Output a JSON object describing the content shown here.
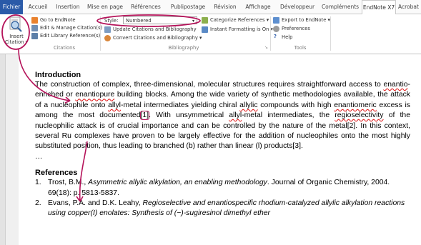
{
  "tabs": [
    {
      "label": "Fichier"
    },
    {
      "label": "Accueil"
    },
    {
      "label": "Insertion"
    },
    {
      "label": "Mise en page"
    },
    {
      "label": "Références"
    },
    {
      "label": "Publipostage"
    },
    {
      "label": "Révision"
    },
    {
      "label": "Affichage"
    },
    {
      "label": "Développeur"
    },
    {
      "label": "Compléments"
    },
    {
      "label": "EndNote X7"
    },
    {
      "label": "Acrobat"
    }
  ],
  "ribbon": {
    "insert_citation": {
      "line1": "Insert",
      "line2": "Citation ▾"
    },
    "citations_group": {
      "go_to_endnote": "Go to EndNote",
      "edit_manage": "Edit & Manage Citation(s)",
      "edit_library": "Edit Library Reference(s)",
      "label": "Citations"
    },
    "bibliography_group": {
      "style_label": "Style:",
      "style_value": "Numbered",
      "categorize": "Categorize References ▾",
      "update": "Update Citations and Bibliography",
      "instant": "Instant Formatting is On ▾",
      "convert": "Convert Citations and Bibliography ▾",
      "label": "Bibliography",
      "launcher": "↘"
    },
    "tools_group": {
      "export": "Export to EndNote ▾",
      "preferences": "Preferences",
      "help": "Help",
      "label": "Tools"
    }
  },
  "document": {
    "heading": "Introduction",
    "intro_para": {
      "s1": "The construction of complex, three-dimensional, molecular structures requires straightforward access to ",
      "w1": "enantio",
      "s2": "-enriched or ",
      "w2": "enantiopure",
      "s3": " building blocks. Among the wide variety of synthetic methodologies available, the attack of a nucleophile onto ",
      "w3": "allyl",
      "s4": "-metal intermediates yielding chiral ",
      "w4": "allylic",
      "s5": " compounds with high ",
      "w5": "enantiomeric",
      "s6": " excess is among the most documented",
      "cite1": "[1]",
      "s7": ". With unsymmetrical ",
      "w6": "allyl",
      "s8": "-metal intermediates, the ",
      "w7": "regioselectivity",
      "s9": " of the nucleophilic attack is of crucial importance and can be controlled by the nature of the metal[2]. In this context, several Ru complexes have proven to be largely effective for the addition of nucleophiles onto the most highly substituted position, thus leading to branched (b) rather than linear (l) products[3]."
    },
    "ellipsis": "…",
    "references_heading": "References",
    "references": [
      {
        "num": "1.",
        "pre": "Trost, B.M., ",
        "title": "Asymmetric allylic alkylation, an enabling methodology",
        "post": ". Journal of Organic Chemistry, 2004. 69(18): p. 5813-5837."
      },
      {
        "num": "2.",
        "pre": "Evans, P.A. and D.K. Leahy, ",
        "title": "Regioselective and enantiospecific rhodium-catalyzed allylic alkylation reactions using copper(I) enolates: Synthesis of (−)-sugiresinol dimethyl ether",
        "post": ""
      }
    ]
  },
  "colors": {
    "file_tab": "#2a5aa8",
    "annotation": "#b5135a",
    "ribbon_bg": "#ffffff"
  }
}
